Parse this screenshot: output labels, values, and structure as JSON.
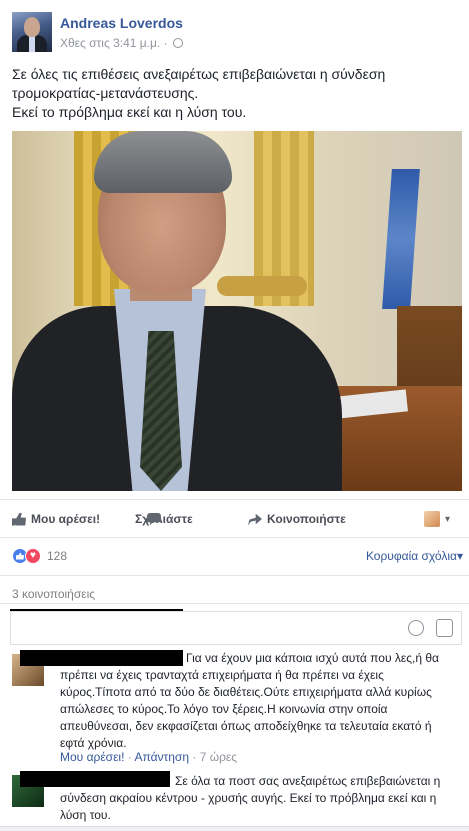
{
  "post": {
    "author": "Andreas Loverdos",
    "timestamp": "Χθες στις 3:41 μ.μ.",
    "separator": "·",
    "privacy_icon": "globe-icon",
    "text_lines": [
      "Σε όλες τις επιθέσεις ανεξαιρέτως επιβεβαιώνεται η σύνδεση",
      "τρομοκρατίας-μετανάστευσης.",
      "Εκεί το πρόβλημα εκεί και η λύση του."
    ]
  },
  "actions": {
    "like": "Μου αρέσει!",
    "comment": "Σχολιάστε",
    "share": "Κοινοποιήστε",
    "caret": "▾"
  },
  "reactions": {
    "count": "128",
    "love_glyph": "♥",
    "top_comments": "Κορυφαία σχόλια",
    "top_comments_caret": "▾"
  },
  "shares": "3 κοινοποιήσεις",
  "comments": [
    {
      "lines": [
        "Για να έχουν μια κάποια ισχύ αυτά που λες,ή θα",
        "πρέπει να έχεις τρανταχτά επιχειρήματα ή θα πρέπει να έχεις",
        "κύρος.Τίποτα από τα δύο δε διαθέτεις.Ούτε επιχειρήματα αλλά κυρίως",
        "απώλεσες το κύρος.Το λόγο τον ξέρεις.Η κοινωνία στην οποία",
        "απευθύνεσαι, δεν εκφασίζεται όπως αποδείχθηκε τα τελευταία εκατό ή",
        "εφτά χρόνια."
      ],
      "like": "Μου αρέσει!",
      "reply": "Απάντηση",
      "dot": "·",
      "time": "7 ώρες"
    },
    {
      "lines": [
        "Σε όλα τα ποστ σας ανεξαιρέτως επιβεβαιώνεται η",
        "σύνδεση ακραίου κέντρου - χρυσής αυγής. Εκεί το πρόβλημα εκεί και η",
        "λύση του."
      ]
    }
  ]
}
